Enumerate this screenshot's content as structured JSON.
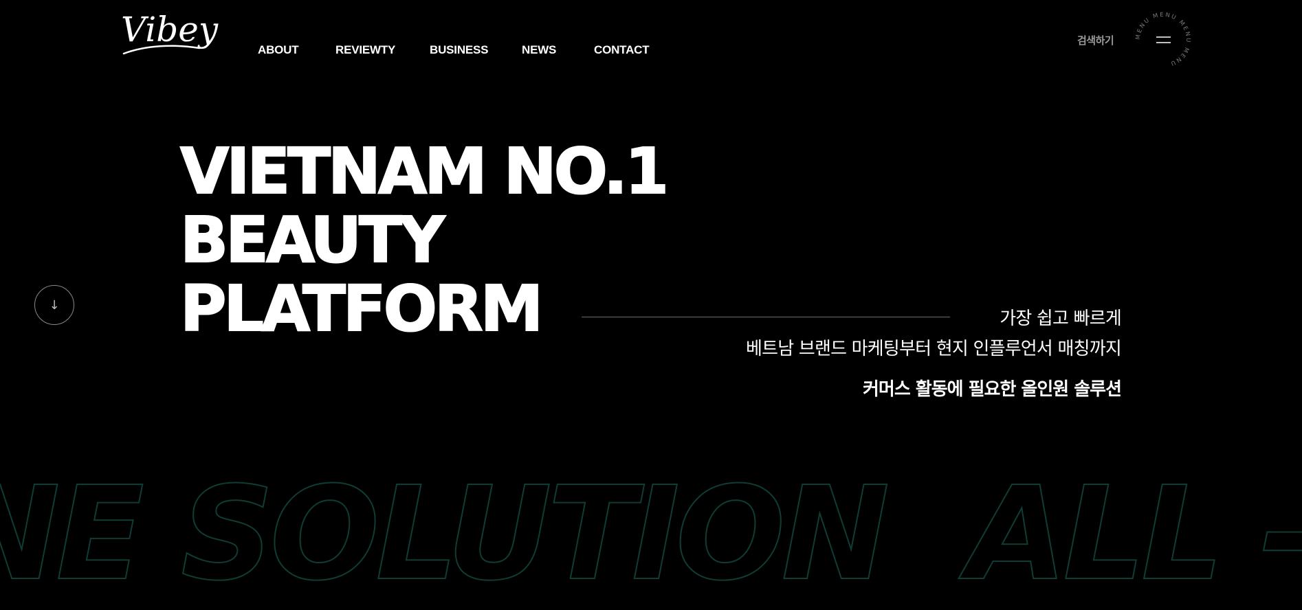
{
  "header": {
    "logo_text": "Vibey",
    "nav": [
      {
        "label": "ABOUT"
      },
      {
        "label": "REVIEWTY"
      },
      {
        "label": "BUSINESS"
      },
      {
        "label": "NEWS"
      },
      {
        "label": "CONTACT"
      }
    ],
    "search_label": "검색하기",
    "menu_ring_text": "MENU MENU MENU MENU",
    "menu_icon": "hamburger-icon"
  },
  "hero": {
    "title_lines": [
      "VIETNAM NO.1",
      "BEAUTY",
      "PLATFORM"
    ],
    "tagline_1": "가장 쉽고 빠르게",
    "tagline_2": "베트남 브랜드 마케팅부터 현지 인플루언서 매칭까지",
    "tagline_3": "커머스 활동에 필요한 올인원 솔루션",
    "scroll_icon": "↓"
  },
  "marquee": {
    "text": "NE SOLUTION  ALL - I"
  },
  "colors": {
    "background": "#000000",
    "text": "#ffffff",
    "muted": "#9a9a9a",
    "outline_accent": "#0f3d36"
  }
}
